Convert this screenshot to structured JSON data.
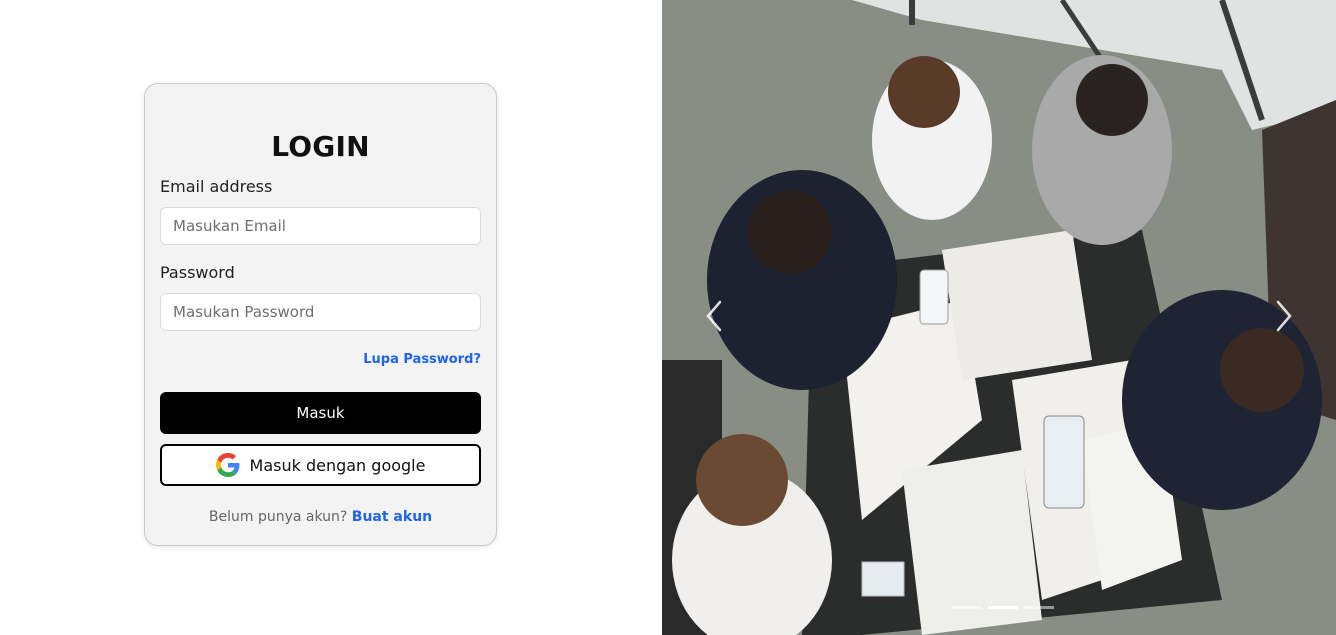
{
  "login": {
    "title": "LOGIN",
    "email_label": "Email address",
    "email_placeholder": "Masukan Email",
    "password_label": "Password",
    "password_placeholder": "Masukan Password",
    "forgot_password": "Lupa Password?",
    "submit_label": "Masuk",
    "google_label": "Masuk dengan google",
    "signup_prompt": "Belum punya akun?",
    "signup_link": "Buat akun"
  },
  "carousel": {
    "slide_count": 3,
    "active_slide": 2,
    "prev_icon": "chevron-left-icon",
    "next_icon": "chevron-right-icon"
  },
  "colors": {
    "accent": "#1f64e8",
    "primary_button": "#000000",
    "card_background": "#f3f3f3"
  }
}
